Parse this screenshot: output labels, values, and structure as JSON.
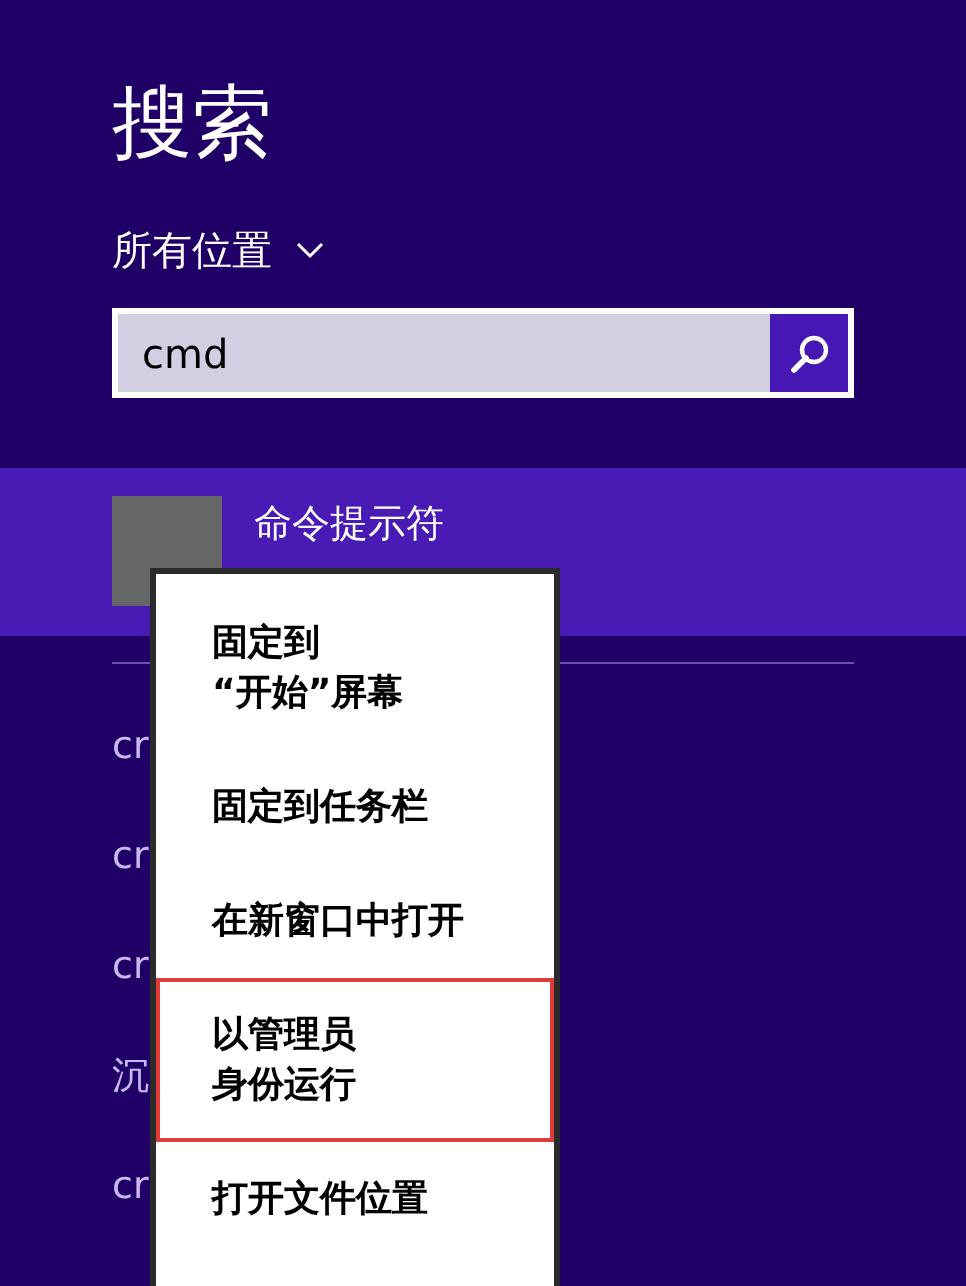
{
  "title": "搜索",
  "scope": {
    "label": "所有位置"
  },
  "search": {
    "value": "cmd"
  },
  "results": [
    {
      "label": "命令提示符",
      "selected": true
    }
  ],
  "other_results": [
    "cr",
    "cr",
    "cr",
    "沉",
    "cr"
  ],
  "context_menu": [
    {
      "lines": [
        "固定到",
        "“开始”屏幕"
      ],
      "highlighted": false
    },
    {
      "lines": [
        "固定到任务栏"
      ],
      "highlighted": false
    },
    {
      "lines": [
        "在新窗口中打开"
      ],
      "highlighted": false
    },
    {
      "lines": [
        "以管理员",
        "身份运行"
      ],
      "highlighted": true
    },
    {
      "lines": [
        "打开文件位置"
      ],
      "highlighted": false
    }
  ]
}
